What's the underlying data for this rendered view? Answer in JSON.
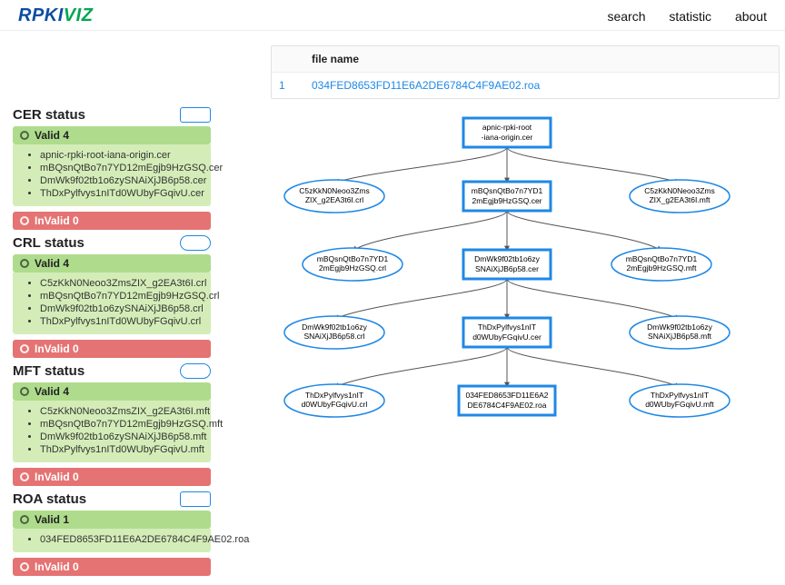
{
  "brand": {
    "left": "RPKI",
    "right": "VIZ"
  },
  "nav": {
    "search": "search",
    "statistic": "statistic",
    "about": "about"
  },
  "table": {
    "header_index": "",
    "header_filename": "file name",
    "row_index": "1",
    "row_filename": "034FED8653FD11E6A2DE6784C4F9AE02.roa"
  },
  "sections": {
    "cer": {
      "title": "CER status",
      "valid_label": "Valid 4",
      "invalid_label": "InValid 0",
      "items": [
        "apnic-rpki-root-iana-origin.cer",
        "mBQsnQtBo7n7YD12mEgjb9HzGSQ.cer",
        "DmWk9f02tb1o6zySNAiXjJB6p58.cer",
        "ThDxPylfvys1nITd0WUbyFGqivU.cer"
      ]
    },
    "crl": {
      "title": "CRL status",
      "valid_label": "Valid 4",
      "invalid_label": "InValid 0",
      "items": [
        "C5zKkN0Neoo3ZmsZIX_g2EA3t6I.crl",
        "mBQsnQtBo7n7YD12mEgjb9HzGSQ.crl",
        "DmWk9f02tb1o6zySNAiXjJB6p58.crl",
        "ThDxPylfvys1nITd0WUbyFGqivU.crl"
      ]
    },
    "mft": {
      "title": "MFT status",
      "valid_label": "Valid 4",
      "invalid_label": "InValid 0",
      "items": [
        "C5zKkN0Neoo3ZmsZIX_g2EA3t6I.mft",
        "mBQsnQtBo7n7YD12mEgjb9HzGSQ.mft",
        "DmWk9f02tb1o6zySNAiXjJB6p58.mft",
        "ThDxPylfvys1nITd0WUbyFGqivU.mft"
      ]
    },
    "roa": {
      "title": "ROA status",
      "valid_label": "Valid 1",
      "invalid_label": "InValid 0",
      "items": [
        "034FED8653FD11E6A2DE6784C4F9AE02.roa"
      ]
    }
  },
  "graph": {
    "n0": {
      "l1": "apnic-rpki-root",
      "l2": "-iana-origin.cer"
    },
    "n1": {
      "l1": "C5zKkN0Neoo3Zms",
      "l2": "ZIX_g2EA3t6I.crl"
    },
    "n2": {
      "l1": "mBQsnQtBo7n7YD1",
      "l2": "2mEgjb9HzGSQ.cer"
    },
    "n3": {
      "l1": "C5zKkN0Neoo3Zms",
      "l2": "ZIX_g2EA3t6I.mft"
    },
    "n4": {
      "l1": "mBQsnQtBo7n7YD1",
      "l2": "2mEgjb9HzGSQ.crl"
    },
    "n5": {
      "l1": "DmWk9f02tb1o6zy",
      "l2": "SNAiXjJB6p58.cer"
    },
    "n6": {
      "l1": "mBQsnQtBo7n7YD1",
      "l2": "2mEgjb9HzGSQ.mft"
    },
    "n7": {
      "l1": "DmWk9f02tb1o6zy",
      "l2": "SNAiXjJB6p58.crl"
    },
    "n8": {
      "l1": "ThDxPylfvys1nIT",
      "l2": "d0WUbyFGqivU.cer"
    },
    "n9": {
      "l1": "DmWk9f02tb1o6zy",
      "l2": "SNAiXjJB6p58.mft"
    },
    "n10": {
      "l1": "ThDxPylfvys1nIT",
      "l2": "d0WUbyFGqivU.crl"
    },
    "n11": {
      "l1": "034FED8653FD11E6A2",
      "l2": "DE6784C4F9AE02.roa"
    },
    "n12": {
      "l1": "ThDxPylfvys1nIT",
      "l2": "d0WUbyFGqivU.mft"
    }
  }
}
